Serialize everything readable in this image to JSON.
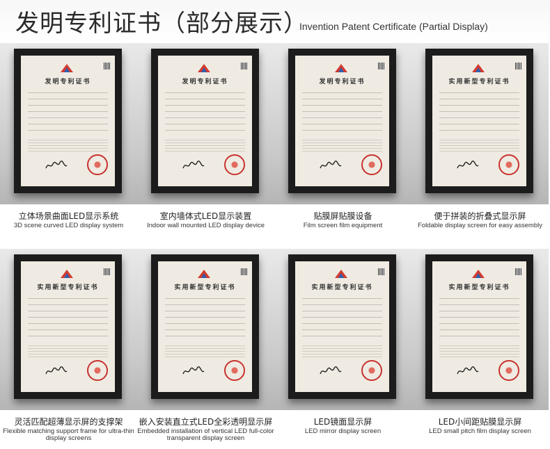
{
  "header": {
    "title_cn": "发明专利证书（部分展示）",
    "title_en": "Invention Patent Certificate (Partial Display)"
  },
  "certificates": [
    {
      "cert_title": "发明专利证书",
      "caption_cn": "立体场景曲面LED显示系统",
      "caption_en": "3D scene curved LED display system"
    },
    {
      "cert_title": "发明专利证书",
      "caption_cn": "室内墙体式LED显示装置",
      "caption_en": "Indoor wall mounted LED display device"
    },
    {
      "cert_title": "发明专利证书",
      "caption_cn": "贴膜屏贴膜设备",
      "caption_en": "Film screen film equipment"
    },
    {
      "cert_title": "实用新型专利证书",
      "caption_cn": "便于拼装的折叠式显示屏",
      "caption_en": "Foldable display screen for easy assembly"
    },
    {
      "cert_title": "实用新型专利证书",
      "caption_cn": "灵活匹配超薄显示屏的支撑架",
      "caption_en": "Flexible matching support frame for ultra-thin display screens"
    },
    {
      "cert_title": "实用新型专利证书",
      "caption_cn": "嵌入安装直立式LED全彩透明显示屏",
      "caption_en": "Embedded installation of vertical LED full-color transparent display screen"
    },
    {
      "cert_title": "实用新型专利证书",
      "caption_cn": "LED镜面显示屏",
      "caption_en": "LED mirror display screen"
    },
    {
      "cert_title": "实用新型专利证书",
      "caption_cn": "LED小间距贴膜显示屏",
      "caption_en": "LED small pitch film display screen"
    }
  ]
}
